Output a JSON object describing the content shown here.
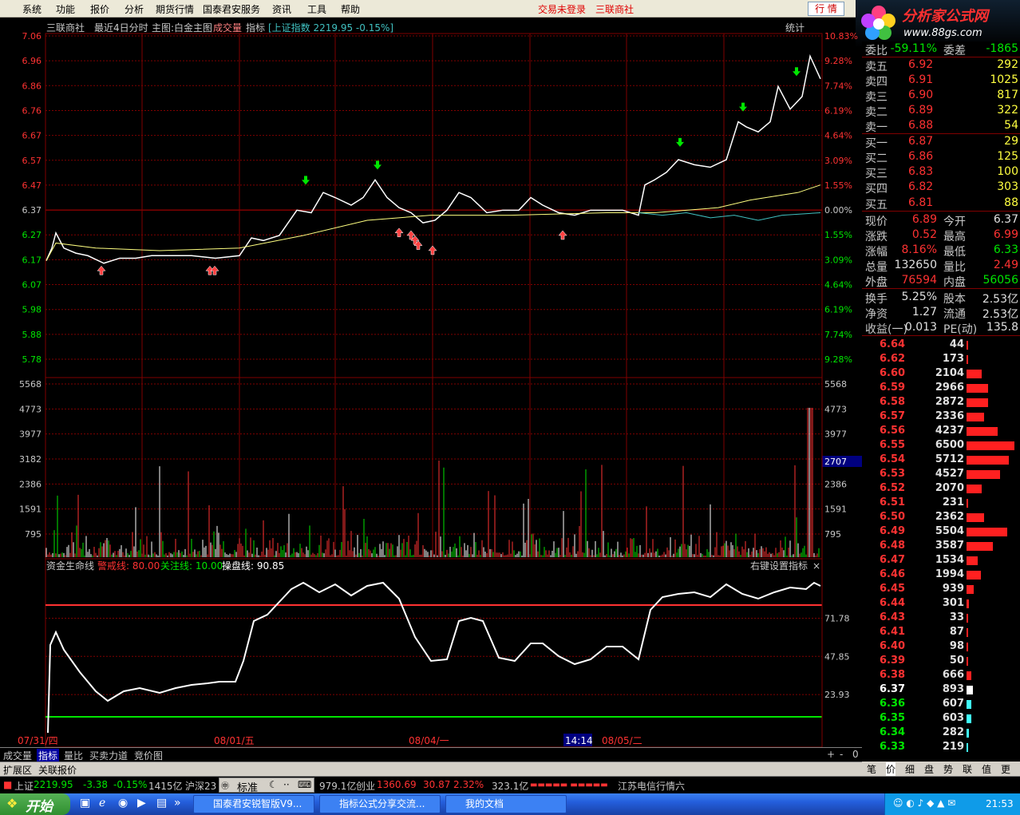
{
  "menu": {
    "items": [
      "系统",
      "功能",
      "报价",
      "分析",
      "期货行情",
      "国泰君安服务",
      "资讯",
      "工具",
      "帮助"
    ],
    "status": "交易未登录",
    "stock_name": "三联商社",
    "trade_btn": "行 情"
  },
  "logo": {
    "title": "分析家公式网",
    "url": "www.88gs.com"
  },
  "header": {
    "name": "三联商社",
    "period": "最近4日分时",
    "main_chart": "主图:白金主图",
    "vol": "成交量",
    "indicator": "指标",
    "index": "[上证指数 2219.95 -0.15%]",
    "stat": "统计"
  },
  "axes": {
    "price_left": [
      "7.06",
      "6.96",
      "6.86",
      "6.76",
      "6.67",
      "6.57",
      "6.47",
      "6.37",
      "6.27",
      "6.17",
      "6.07",
      "5.98",
      "5.88",
      "5.78"
    ],
    "pct_right": [
      "10.83%",
      "9.28%",
      "7.74%",
      "6.19%",
      "4.64%",
      "3.09%",
      "1.55%",
      "0.00%",
      "1.55%",
      "3.09%",
      "4.64%",
      "6.19%",
      "7.74%",
      "9.28%"
    ],
    "vol_left": [
      "5568",
      "4773",
      "3977",
      "3182",
      "2386",
      "1591",
      "795"
    ],
    "vol_right": [
      "5568",
      "4773",
      "3977",
      "3182",
      "2386",
      "1591",
      "795"
    ],
    "vol_current": "2707",
    "ind_right": [
      "71.78",
      "47.85",
      "23.93"
    ],
    "dates": [
      "07/31/四",
      "08/01/五",
      "08/04/一",
      "08/05/二"
    ],
    "cursor_time": "14:14"
  },
  "indicator": {
    "name": "资金生命线",
    "warn_label": "警戒线: 80.00",
    "focus_label": "关注线: 10.00",
    "operate_label": "操盘线: 90.85",
    "hint": "右键设置指标",
    "warn": 80,
    "focus": 10,
    "current": 90.85
  },
  "quote": {
    "rows": [
      {
        "l": "委比",
        "v": "-59.11%",
        "l2": "委差",
        "v2": "-1865"
      },
      {
        "l": "卖五",
        "v": "6.92",
        "v2": "292"
      },
      {
        "l": "卖四",
        "v": "6.91",
        "v2": "1025"
      },
      {
        "l": "卖三",
        "v": "6.90",
        "v2": "817"
      },
      {
        "l": "卖二",
        "v": "6.89",
        "v2": "322"
      },
      {
        "l": "卖一",
        "v": "6.88",
        "v2": "54"
      },
      {
        "l": "买一",
        "v": "6.87",
        "v2": "29"
      },
      {
        "l": "买二",
        "v": "6.86",
        "v2": "125"
      },
      {
        "l": "买三",
        "v": "6.83",
        "v2": "100"
      },
      {
        "l": "买四",
        "v": "6.82",
        "v2": "303"
      },
      {
        "l": "买五",
        "v": "6.81",
        "v2": "88"
      },
      {
        "l": "现价",
        "v": "6.89",
        "l2": "今开",
        "v2": "6.37"
      },
      {
        "l": "涨跌",
        "v": "0.52",
        "l2": "最高",
        "v2": "6.99"
      },
      {
        "l": "涨幅",
        "v": "8.16%",
        "l2": "最低",
        "v2": "6.33"
      },
      {
        "l": "总量",
        "v": "132650",
        "l2": "量比",
        "v2": "2.49"
      },
      {
        "l": "外盘",
        "v": "76594",
        "l2": "内盘",
        "v2": "56056"
      },
      {
        "l": "换手",
        "v": "5.25%",
        "l2": "股本",
        "v2": "2.53亿"
      },
      {
        "l": "净资",
        "v": "1.27",
        "l2": "流通",
        "v2": "2.53亿"
      },
      {
        "l": "收益(一)",
        "v": "0.013",
        "l2": "PE(动)",
        "v2": "135.8"
      }
    ]
  },
  "depth": [
    [
      "6.64",
      "44"
    ],
    [
      "6.62",
      "173"
    ],
    [
      "6.60",
      "2104"
    ],
    [
      "6.59",
      "2966"
    ],
    [
      "6.58",
      "2872"
    ],
    [
      "6.57",
      "2336"
    ],
    [
      "6.56",
      "4237"
    ],
    [
      "6.55",
      "6500"
    ],
    [
      "6.54",
      "5712"
    ],
    [
      "6.53",
      "4527"
    ],
    [
      "6.52",
      "2070"
    ],
    [
      "6.51",
      "231"
    ],
    [
      "6.50",
      "2362"
    ],
    [
      "6.49",
      "5504"
    ],
    [
      "6.48",
      "3587"
    ],
    [
      "6.47",
      "1534"
    ],
    [
      "6.46",
      "1994"
    ],
    [
      "6.45",
      "939"
    ],
    [
      "6.44",
      "301"
    ],
    [
      "6.43",
      "33"
    ],
    [
      "6.41",
      "87"
    ],
    [
      "6.40",
      "98"
    ],
    [
      "6.39",
      "50"
    ],
    [
      "6.38",
      "666"
    ],
    [
      "6.37",
      "893"
    ],
    [
      "6.36",
      "607"
    ],
    [
      "6.35",
      "603"
    ],
    [
      "6.34",
      "282"
    ],
    [
      "6.33",
      "219"
    ]
  ],
  "bottom_tabs": [
    "成交量",
    "指标",
    "量比",
    "买卖力道",
    "竞价图"
  ],
  "bottom_right": [
    "+",
    "-",
    "0"
  ],
  "tabs2": [
    "扩展区",
    "关联报价"
  ],
  "right_tabs": [
    "笔",
    "价",
    "细",
    "盘",
    "势",
    "联",
    "值",
    "更"
  ],
  "ticker": {
    "sh_label": "上证",
    "sh": "2219.95",
    "sh_chg": "-3.38",
    "sh_pct": "-0.15%",
    "sh_amt": "1415亿",
    "hs": "沪深23",
    "std": "标准",
    "amt2": "979.1亿",
    "cy_label": "创业",
    "cy": "1360.69",
    "cy_chg": "30.87",
    "cy_pct": "2.32%",
    "cy_amt": "323.1亿",
    "news": "江苏电信行情六"
  },
  "taskbar": {
    "start": "开始",
    "tasks": [
      "国泰君安锐智版V9...",
      "指标公式分享交流...",
      "我的文档"
    ],
    "clock": "21:53"
  },
  "colors": {
    "up": "#ff3232",
    "down": "#00e600",
    "grid": "#800000",
    "price": "#ffffff",
    "avg": "#ffff80",
    "index": "#40c0c0"
  }
}
